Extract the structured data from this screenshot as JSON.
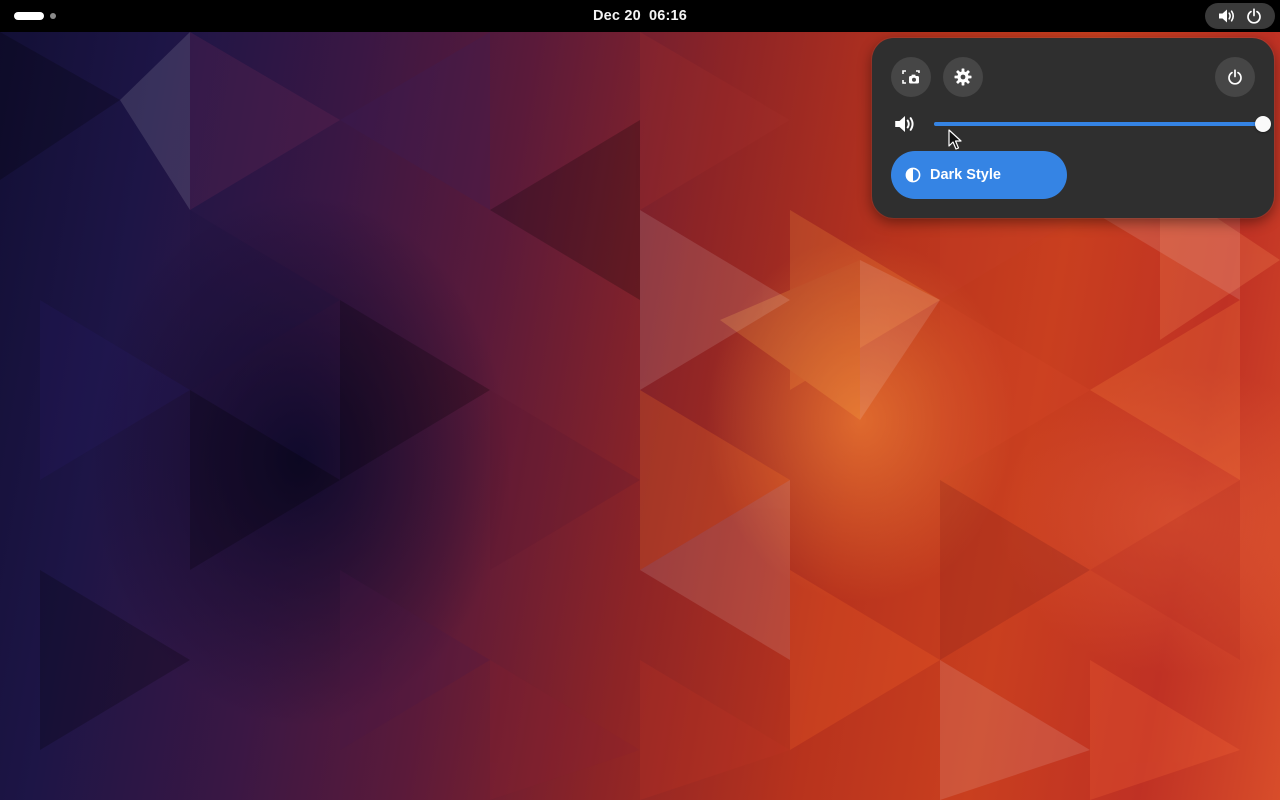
{
  "topbar": {
    "date": "Dec 20",
    "time": "06:16",
    "workspaces": {
      "count": 2,
      "active": 1
    },
    "status_icons": [
      "volume-high-icon",
      "power-icon"
    ]
  },
  "quick_settings": {
    "buttons": [
      "screenshot-icon",
      "gear-icon",
      "power-icon"
    ],
    "volume": {
      "icon": "volume-high-icon",
      "level": 1.0
    },
    "toggles": [
      {
        "label": "Dark Style",
        "icon": "contrast-icon",
        "active": true
      }
    ]
  },
  "colors": {
    "accent": "#3584e4",
    "topbar": "#000000",
    "popover": "#2f2f2f",
    "button": "#464646"
  }
}
